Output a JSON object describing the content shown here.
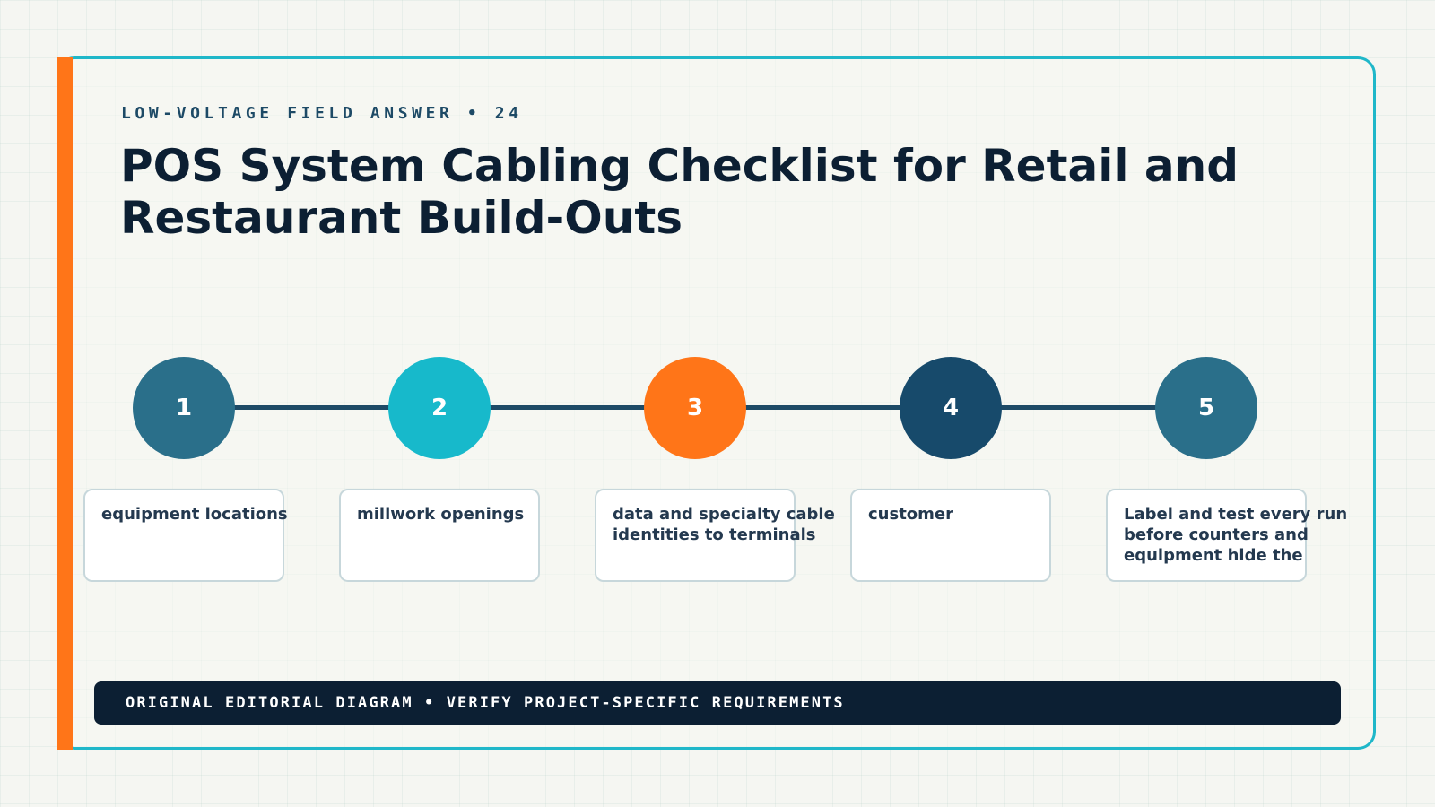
{
  "eyebrow": "LOW-VOLTAGE FIELD ANSWER • 24",
  "title": "POS System Cabling Checklist for Retail and Restaurant Build-Outs",
  "steps": [
    {
      "number": "1",
      "text": "equipment locations",
      "color": "#2a6f8a"
    },
    {
      "number": "2",
      "text": "millwork openings",
      "color": "#17b9cb"
    },
    {
      "number": "3",
      "text": "data and specialty cable identities to terminals",
      "color": "#ff7518"
    },
    {
      "number": "4",
      "text": "customer",
      "color": "#174a6b"
    },
    {
      "number": "5",
      "text": "Label and test every run before counters and equipment hide the",
      "color": "#2a6f8a"
    }
  ],
  "footer": "ORIGINAL EDITORIAL DIAGRAM • VERIFY PROJECT-SPECIFIC REQUIREMENTS",
  "colors": {
    "accent": "#ff7518",
    "frame": "#1fb7c9",
    "navy": "#0c1f33",
    "connector": "#1d4a66"
  }
}
